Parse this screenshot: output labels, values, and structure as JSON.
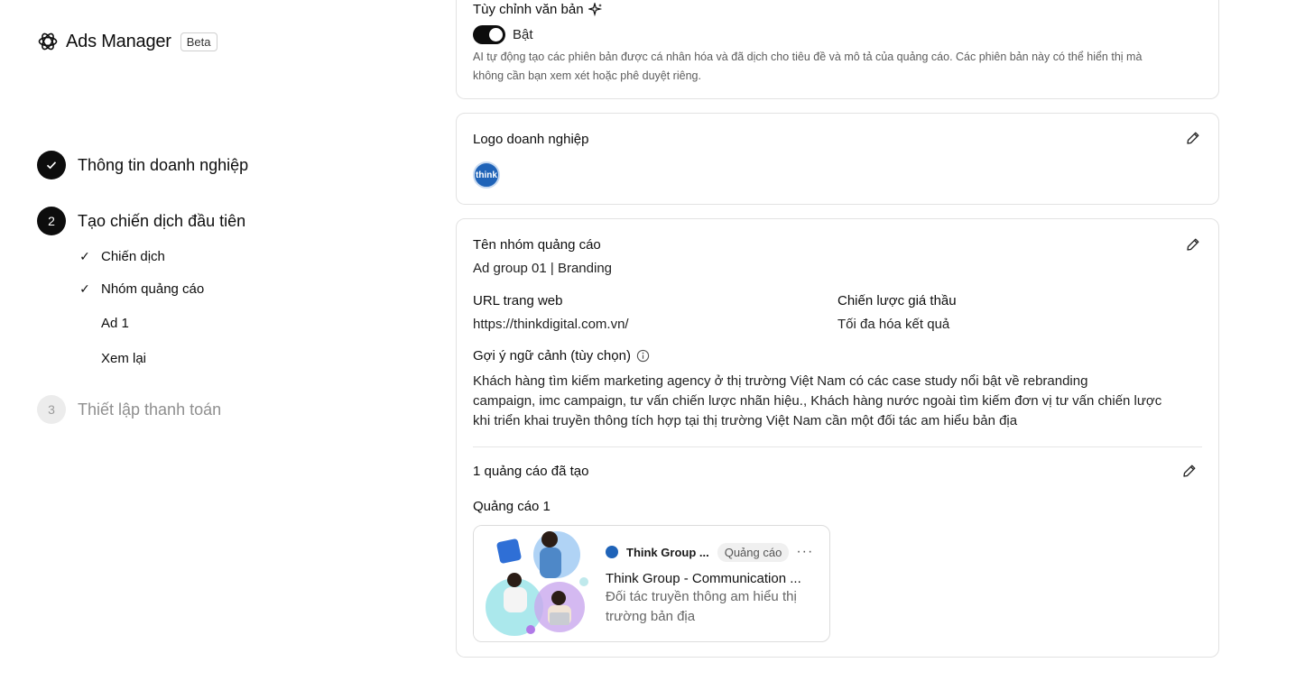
{
  "brand": {
    "title": "Ads Manager",
    "badge": "Beta"
  },
  "steps": [
    {
      "number": "",
      "label": "Thông tin doanh nghiệp"
    },
    {
      "number": "2",
      "label": "Tạo chiến dịch đầu tiên"
    },
    {
      "number": "3",
      "label": "Thiết lập thanh toán"
    }
  ],
  "substeps": [
    {
      "label": "Chiến dịch",
      "check": "✓"
    },
    {
      "label": "Nhóm quảng cáo",
      "check": "✓"
    },
    {
      "label": "Ad 1",
      "check": ""
    },
    {
      "label": "Xem lại",
      "check": ""
    }
  ],
  "customize_text": {
    "title": "Tùy chỉnh văn bản",
    "toggle_label": "Bật",
    "description_line1": "AI tự động tạo các phiên bản được cá nhân hóa và đã dịch cho tiêu đề và mô tả của quảng cáo. Các phiên bản này có thể hiển thị mà",
    "description_line2": "không cần bạn xem xét hoặc phê duyệt riêng."
  },
  "business_logo": {
    "title": "Logo doanh nghiệp",
    "logo_text": "think"
  },
  "ad_group": {
    "name_label": "Tên nhóm quảng cáo",
    "name_value": "Ad group 01 | Branding",
    "url_label": "URL trang web",
    "url_value": "https://thinkdigital.com.vn/",
    "bid_label": "Chiến lược giá thầu",
    "bid_value": "Tối đa hóa kết quả",
    "context_label": "Gợi ý ngữ cảnh (tùy chọn)",
    "context_line1": "Khách hàng tìm kiếm marketing agency ở thị trường Việt Nam có các case study nổi bật về rebranding",
    "context_line2": "campaign, imc campaign, tư vấn chiến lược nhãn hiệu., Khách hàng nước ngoài tìm kiếm đơn vị tư vấn chiến lược",
    "context_line3": "khi triển khai truyền thông tích hợp tại thị trường Việt Nam cần một đối tác am hiểu bản địa"
  },
  "ads": {
    "count_label": "1 quảng cáo đã tạo",
    "ad_label": "Quảng cáo 1",
    "preview": {
      "account": "Think Group ...",
      "tag": "Quảng cáo",
      "more": "···",
      "title": "Think Group - Communication ...",
      "desc_line1": "Đối tác truyền thông am hiểu thị",
      "desc_line2": "trường bản địa"
    }
  },
  "icons": {
    "brand": "openai-knot-icon",
    "sparkle": "sparkle-icon",
    "edit": "pencil-icon",
    "info": "info-icon",
    "check": "check-icon"
  },
  "colors": {
    "accent": "#0d0d0d",
    "muted": "#8f8f8f",
    "logo_blue": "#1f63b8"
  }
}
